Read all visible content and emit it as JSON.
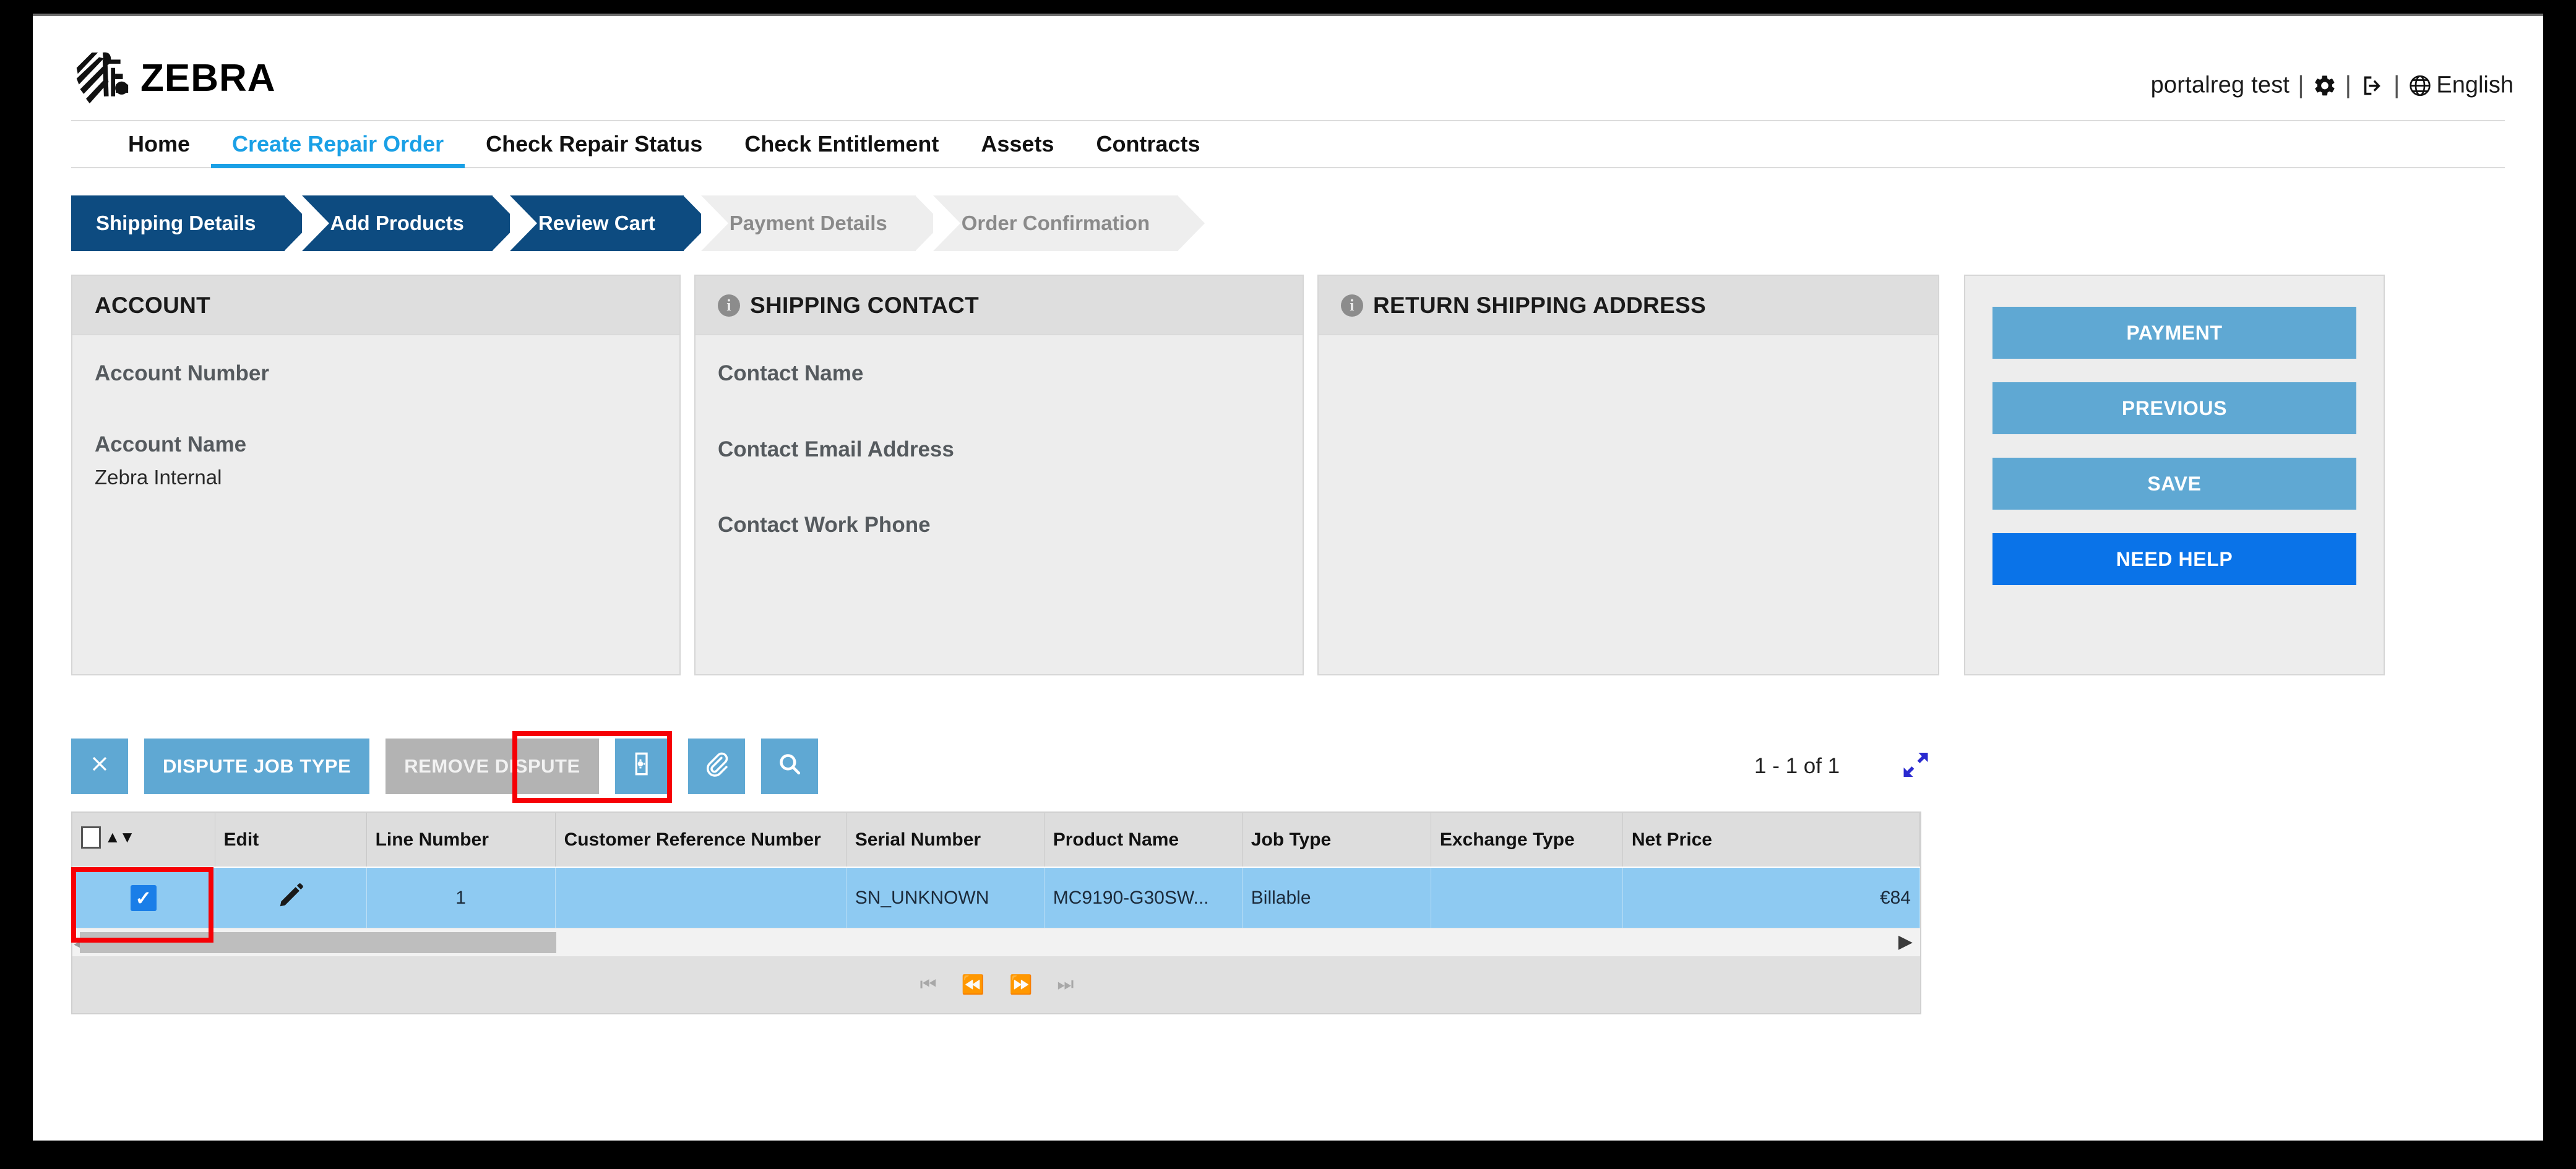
{
  "header": {
    "brand": "ZEBRA",
    "brand_icon": "zebra-logo-icon",
    "user_name": "portalreg test",
    "separator": "|",
    "settings_icon": "gear-icon",
    "logout_icon": "logout-icon",
    "globe_icon": "globe-icon",
    "language": "English"
  },
  "nav": {
    "items": [
      {
        "label": "Home",
        "active": false
      },
      {
        "label": "Create Repair Order",
        "active": true
      },
      {
        "label": "Check Repair Status",
        "active": false
      },
      {
        "label": "Check Entitlement",
        "active": false
      },
      {
        "label": "Assets",
        "active": false
      },
      {
        "label": "Contracts",
        "active": false
      }
    ]
  },
  "wizard": {
    "steps": [
      {
        "label": "Shipping Details",
        "state": "done"
      },
      {
        "label": "Add Products",
        "state": "done"
      },
      {
        "label": "Review Cart",
        "state": "current"
      },
      {
        "label": "Payment Details",
        "state": "inactive"
      },
      {
        "label": "Order Confirmation",
        "state": "inactive"
      }
    ]
  },
  "panels": {
    "account": {
      "title": "ACCOUNT",
      "has_info_icon": false,
      "fields": [
        {
          "label": "Account Number",
          "value": ""
        },
        {
          "label": "Account Name",
          "value": "Zebra Internal"
        }
      ]
    },
    "shipping_contact": {
      "title": "SHIPPING CONTACT",
      "has_info_icon": true,
      "info_icon": "info-icon",
      "fields": [
        {
          "label": "Contact Name",
          "value": ""
        },
        {
          "label": "Contact Email Address",
          "value": ""
        },
        {
          "label": "Contact Work Phone",
          "value": ""
        }
      ]
    },
    "return_shipping_address": {
      "title": "RETURN SHIPPING ADDRESS",
      "has_info_icon": true,
      "info_icon": "info-icon",
      "fields": []
    }
  },
  "side_actions": {
    "buttons": [
      {
        "label": "PAYMENT",
        "style": "secondary"
      },
      {
        "label": "PREVIOUS",
        "style": "secondary"
      },
      {
        "label": "SAVE",
        "style": "secondary"
      },
      {
        "label": "NEED HELP",
        "style": "primary"
      }
    ]
  },
  "toolbar": {
    "buttons": [
      {
        "label": "✖",
        "name": "clear-button",
        "kind": "icon",
        "icon": "close-x-icon",
        "disabled": false
      },
      {
        "label": "DISPUTE JOB TYPE",
        "name": "dispute-job-type-button",
        "kind": "text",
        "disabled": false
      },
      {
        "label": "REMOVE DISPUTE",
        "name": "remove-dispute-button",
        "kind": "text",
        "disabled": true,
        "highlighted": true
      },
      {
        "label": "",
        "name": "device-settings-button",
        "kind": "icon",
        "icon": "device-gear-icon",
        "disabled": false
      },
      {
        "label": "",
        "name": "attachment-button",
        "kind": "icon",
        "icon": "paperclip-icon",
        "disabled": false
      },
      {
        "label": "",
        "name": "search-button",
        "kind": "icon",
        "icon": "search-icon",
        "disabled": false
      }
    ],
    "pager_info": "1 - 1 of 1",
    "expand_icon": "expand-diagonal-icon"
  },
  "table": {
    "columns": [
      "",
      "Edit",
      "Line Number",
      "Customer Reference Number",
      "Serial Number",
      "Product Name",
      "Job Type",
      "Exchange Type",
      "Net Price"
    ],
    "header_checkbox_checked": false,
    "sort_arrows": "▲▼",
    "rows": [
      {
        "selected": true,
        "edit_icon": "pencil-icon",
        "line_number": "1",
        "customer_reference_number": "",
        "serial_number": "SN_UNKNOWN",
        "product_name": "MC9190-G30SW...",
        "job_type": "Billable",
        "exchange_type": "",
        "net_price": "€84"
      }
    ],
    "pagination": {
      "first": "⏮",
      "prev": "⏪",
      "next": "⏩",
      "last": "⏭"
    }
  },
  "colors": {
    "brand_blue": "#1aa0e6",
    "wizard_active": "#0d4b80",
    "wizard_inactive": "#eeeeee",
    "button_blue": "#5fa8d3",
    "primary_blue": "#0a73e8",
    "row_selected": "#8ecaf2",
    "highlight_red": "#f60005",
    "disabled_gray": "#b3b3b3"
  }
}
